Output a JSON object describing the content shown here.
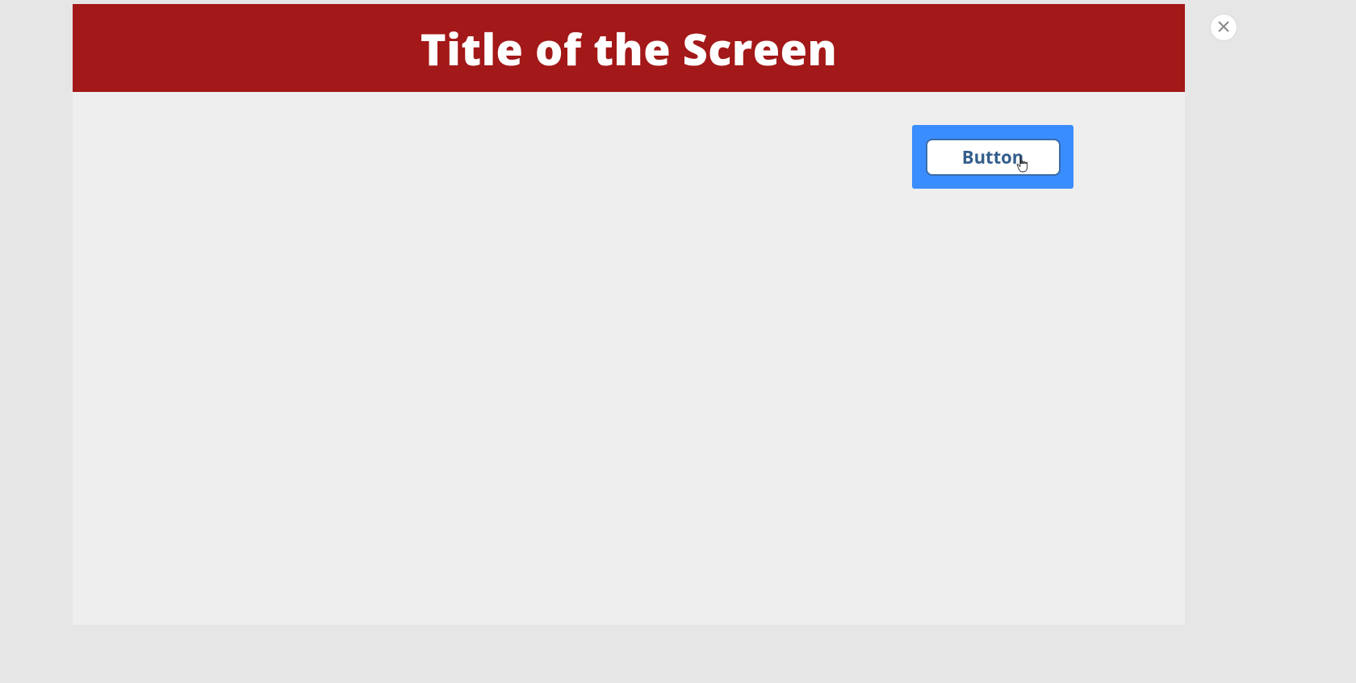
{
  "header": {
    "title": "Title of the Screen",
    "header_background": "#a31818",
    "title_color": "#ffffff"
  },
  "toolbar": {
    "button_label": "Button",
    "highlight_color": "#3a8dff"
  },
  "icons": {
    "close": "close-icon",
    "cursor": "pointer-cursor-icon"
  }
}
